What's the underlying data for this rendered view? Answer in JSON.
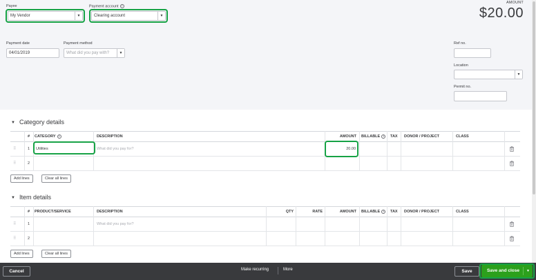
{
  "header": {
    "payee_label": "Payee",
    "payee_value": "My Vendor",
    "payment_account_label": "Payment account",
    "payment_account_value": "Clearing account",
    "amount_label": "AMOUNT",
    "amount_value": "$20.00",
    "payment_date_label": "Payment date",
    "payment_date_value": "04/01/2019",
    "payment_method_label": "Payment method",
    "payment_method_placeholder": "What did you pay with?",
    "ref_no_label": "Ref no.",
    "ref_no_value": "",
    "location_label": "Location",
    "location_value": "",
    "permit_no_label": "Permit no.",
    "permit_no_value": ""
  },
  "category_details": {
    "title": "Category details",
    "columns": [
      "#",
      "CATEGORY",
      "DESCRIPTION",
      "AMOUNT",
      "BILLABLE",
      "TAX",
      "DONOR / PROJECT",
      "CLASS"
    ],
    "rows": [
      {
        "num": "1",
        "category": "Utilities",
        "description_placeholder": "What did you pay for?",
        "amount": "20.00"
      },
      {
        "num": "2",
        "category": "",
        "description_placeholder": "",
        "amount": ""
      }
    ],
    "add_lines": "Add lines",
    "clear_all_lines": "Clear all lines"
  },
  "item_details": {
    "title": "Item details",
    "columns": [
      "#",
      "PRODUCT/SERVICE",
      "DESCRIPTION",
      "QTY",
      "RATE",
      "AMOUNT",
      "BILLABLE",
      "TAX",
      "DONOR / PROJECT",
      "CLASS"
    ],
    "rows": [
      {
        "num": "1",
        "description_placeholder": "What did you pay for?"
      },
      {
        "num": "2",
        "description_placeholder": ""
      }
    ],
    "add_lines": "Add lines",
    "clear_all_lines": "Clear all lines"
  },
  "footer": {
    "cancel": "Cancel",
    "make_recurring": "Make recurring",
    "more": "More",
    "save": "Save",
    "save_and_close": "Save and close"
  },
  "colors": {
    "highlight": "#16a245",
    "primary_button": "#2ca01c",
    "footer_bg": "#393a3d",
    "header_bg": "#f4f5f8"
  },
  "icons": {
    "dropdown": "chevron-down-icon",
    "help": "question-circle-icon",
    "delete": "trash-icon",
    "drag": "drag-handle-icon",
    "collapse": "caret-down-icon"
  }
}
